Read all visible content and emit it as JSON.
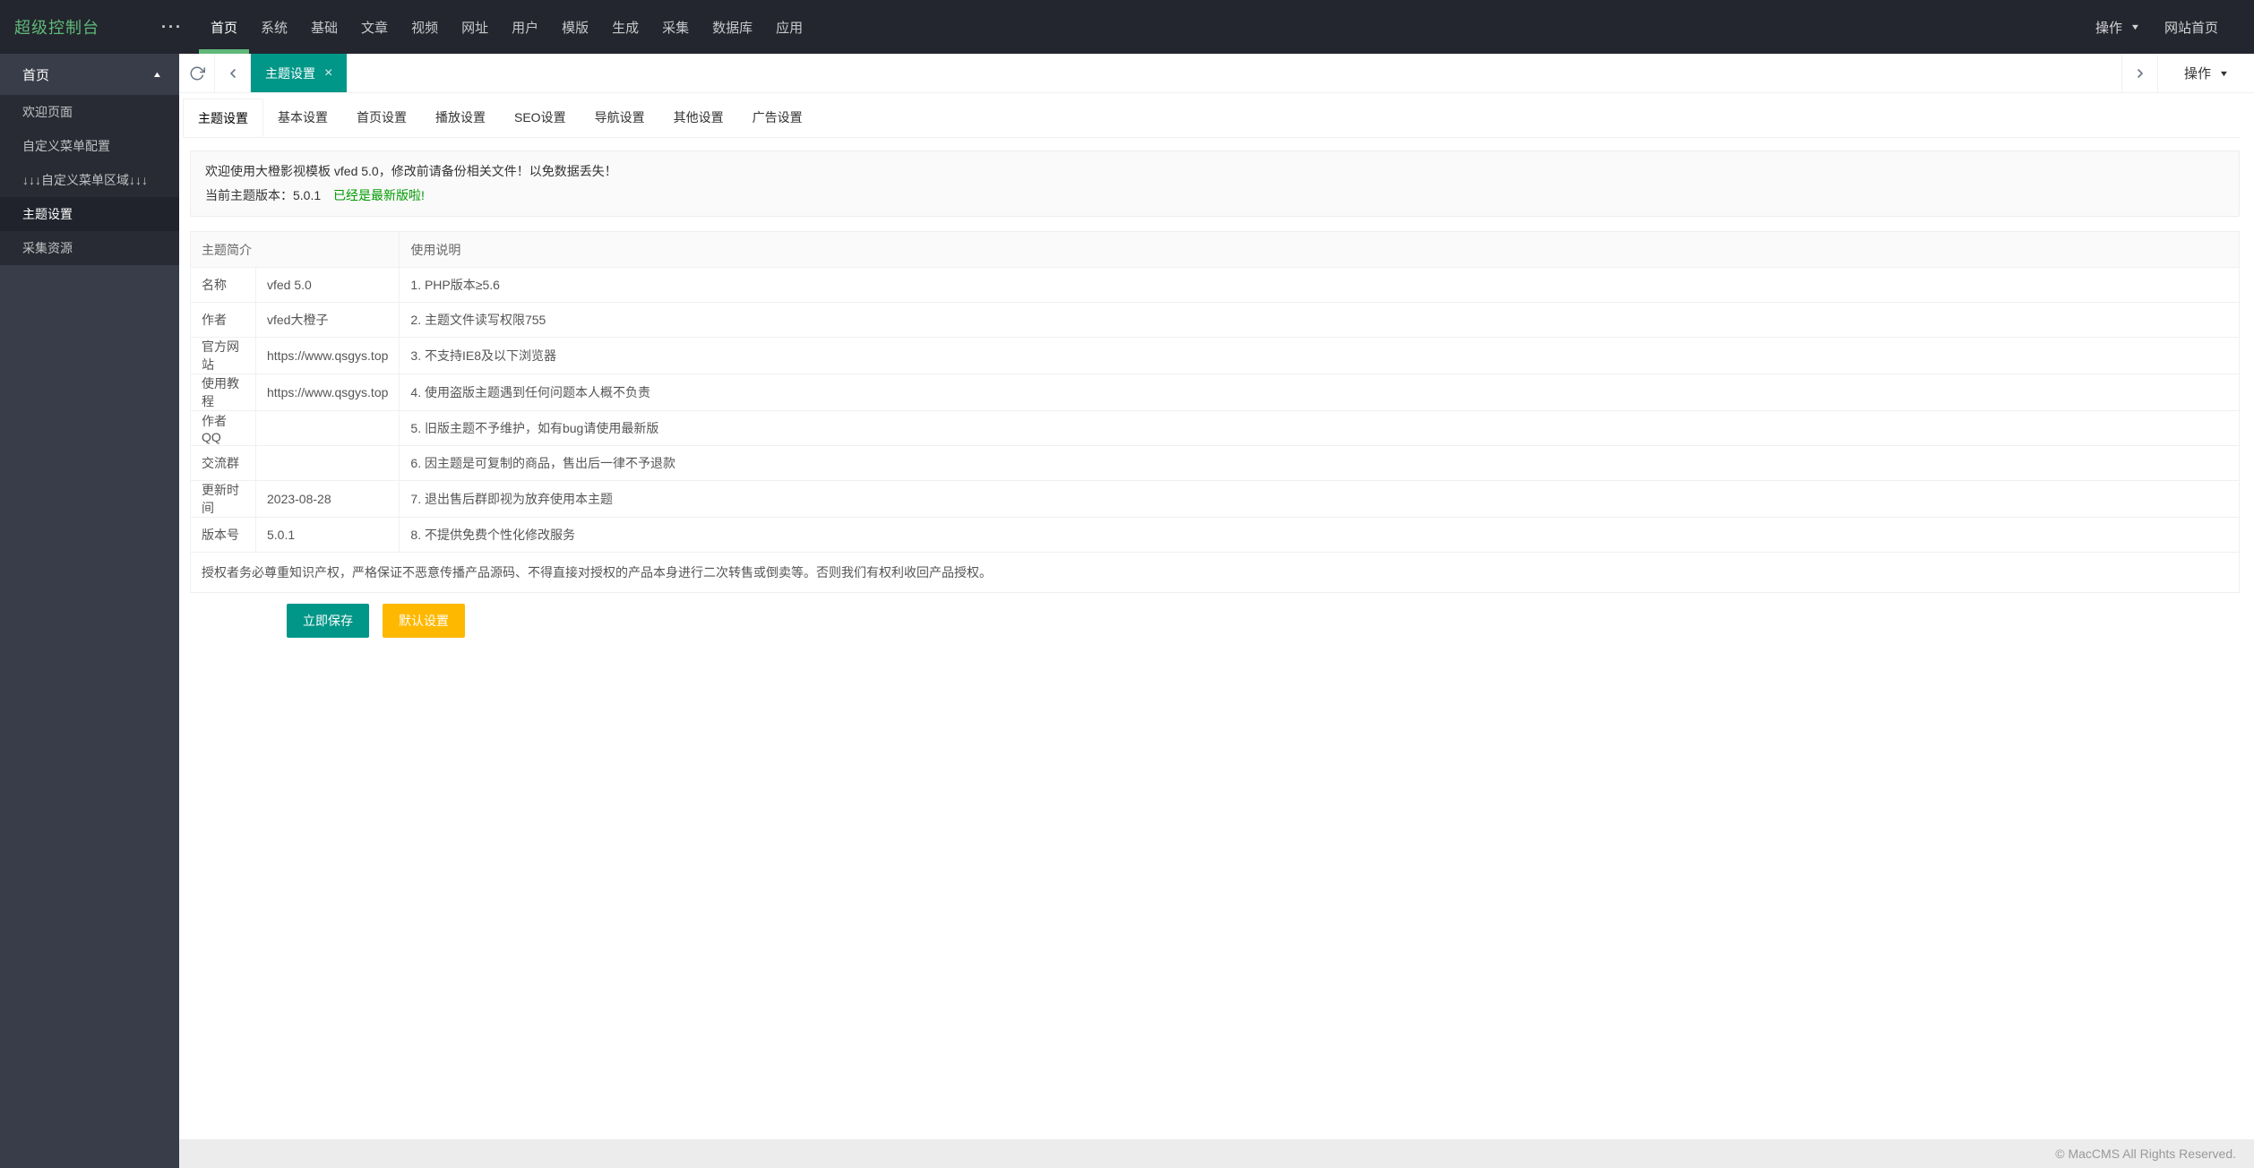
{
  "icons": {
    "ellipsis": "···",
    "caret_down": "▼",
    "caret_up": "▲",
    "close": "×"
  },
  "topbar": {
    "logo": "超级控制台",
    "nav": [
      {
        "label": "首页",
        "active": true
      },
      {
        "label": "系统",
        "active": false
      },
      {
        "label": "基础",
        "active": false
      },
      {
        "label": "文章",
        "active": false
      },
      {
        "label": "视频",
        "active": false
      },
      {
        "label": "网址",
        "active": false
      },
      {
        "label": "用户",
        "active": false
      },
      {
        "label": "模版",
        "active": false
      },
      {
        "label": "生成",
        "active": false
      },
      {
        "label": "采集",
        "active": false
      },
      {
        "label": "数据库",
        "active": false
      },
      {
        "label": "应用",
        "active": false
      }
    ],
    "right_action": "操作",
    "site_home": "网站首页"
  },
  "sidebar": {
    "group": "首页",
    "items": [
      {
        "label": "欢迎页面",
        "active": false
      },
      {
        "label": "自定义菜单配置",
        "active": false
      },
      {
        "label": "↓↓↓自定义菜单区域↓↓↓",
        "active": false
      },
      {
        "label": "主题设置",
        "active": true
      },
      {
        "label": "采集资源",
        "active": false
      }
    ]
  },
  "pagetabs": {
    "active_tab": "主题设置",
    "more_label": "操作"
  },
  "subtabs": [
    {
      "label": "主题设置",
      "active": true
    },
    {
      "label": "基本设置",
      "active": false
    },
    {
      "label": "首页设置",
      "active": false
    },
    {
      "label": "播放设置",
      "active": false
    },
    {
      "label": "SEO设置",
      "active": false
    },
    {
      "label": "导航设置",
      "active": false
    },
    {
      "label": "其他设置",
      "active": false
    },
    {
      "label": "广告设置",
      "active": false
    }
  ],
  "notice": {
    "line1": "欢迎使用大橙影视模板 vfed 5.0，修改前请备份相关文件！以免数据丢失！",
    "line2_prefix": "当前主题版本：5.0.1",
    "line2_highlight": "已经是最新版啦!"
  },
  "table": {
    "headers": {
      "intro": "主题简介",
      "usage": "使用说明"
    },
    "rows": [
      {
        "label": "名称",
        "value": "vfed 5.0",
        "note": "1. PHP版本≥5.6"
      },
      {
        "label": "作者",
        "value": "vfed大橙子",
        "note": "2. 主题文件读写权限755"
      },
      {
        "label": "官方网站",
        "value": "https://www.qsgys.top",
        "note": "3. 不支持IE8及以下浏览器"
      },
      {
        "label": "使用教程",
        "value": "https://www.qsgys.top",
        "note": "4. 使用盗版主题遇到任何问题本人概不负责"
      },
      {
        "label": "作者QQ",
        "value": "",
        "note": "5. 旧版主题不予维护，如有bug请使用最新版"
      },
      {
        "label": "交流群",
        "value": "",
        "note": "6. 因主题是可复制的商品，售出后一律不予退款"
      },
      {
        "label": "更新时间",
        "value": "2023-08-28",
        "note": "7. 退出售后群即视为放弃使用本主题"
      },
      {
        "label": "版本号",
        "value": "5.0.1",
        "note": "8. 不提供免费个性化修改服务"
      }
    ],
    "license": "授权者务必尊重知识产权，严格保证不恶意传播产品源码、不得直接对授权的产品本身进行二次转售或倒卖等。否则我们有权利收回产品授权。"
  },
  "buttons": {
    "save": "立即保存",
    "default": "默认设置"
  },
  "footer": {
    "copyright": "© MacCMS All Rights Reserved."
  },
  "colors": {
    "accent_teal": "#009688",
    "warn_yellow": "#FFB800",
    "brand_green": "#5FB878",
    "success_text": "#009900",
    "topbar_bg": "#23262E",
    "sidebar_bg": "#393D49"
  }
}
